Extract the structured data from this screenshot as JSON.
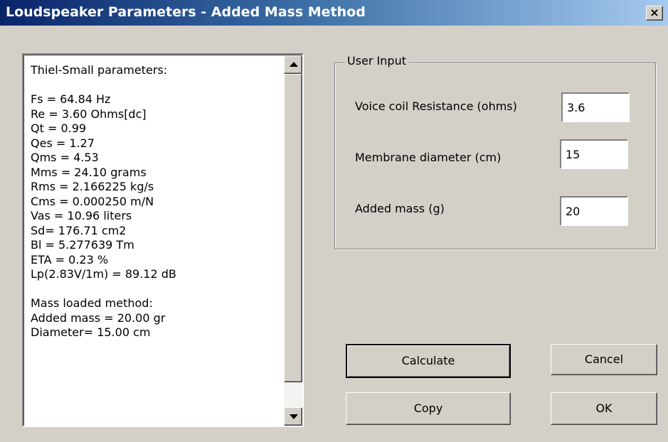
{
  "window": {
    "title": "Loudspeaker Parameters - Added Mass Method",
    "close_glyph": "×"
  },
  "results": {
    "lines": [
      "Thiel-Small parameters:",
      "",
      "Fs  = 64.84 Hz",
      "Re  = 3.60 Ohms[dc]",
      "Qt  = 0.99",
      "Qes = 1.27",
      "Qms = 4.53",
      "Mms = 24.10 grams",
      "Rms = 2.166225 kg/s",
      "Cms = 0.000250 m/N",
      "Vas = 10.96 liters",
      "Sd= 176.71 cm2",
      "Bl  = 5.277639 Tm",
      "ETA = 0.23 %",
      "Lp(2.83V/1m) = 89.12 dB",
      "",
      "Mass loaded method:",
      "Added mass = 20.00 gr",
      "Diameter= 15.00 cm"
    ]
  },
  "user_input": {
    "group_label": "User Input",
    "voice_coil_label": "Voice coil Resistance (ohms)",
    "voice_coil_value": "3.6",
    "diameter_label": "Membrane diameter (cm)",
    "diameter_value": "15",
    "added_mass_label": "Added mass (g)",
    "added_mass_value": "20"
  },
  "buttons": {
    "calculate": "Calculate",
    "cancel": "Cancel",
    "copy": "Copy",
    "ok": "OK"
  }
}
